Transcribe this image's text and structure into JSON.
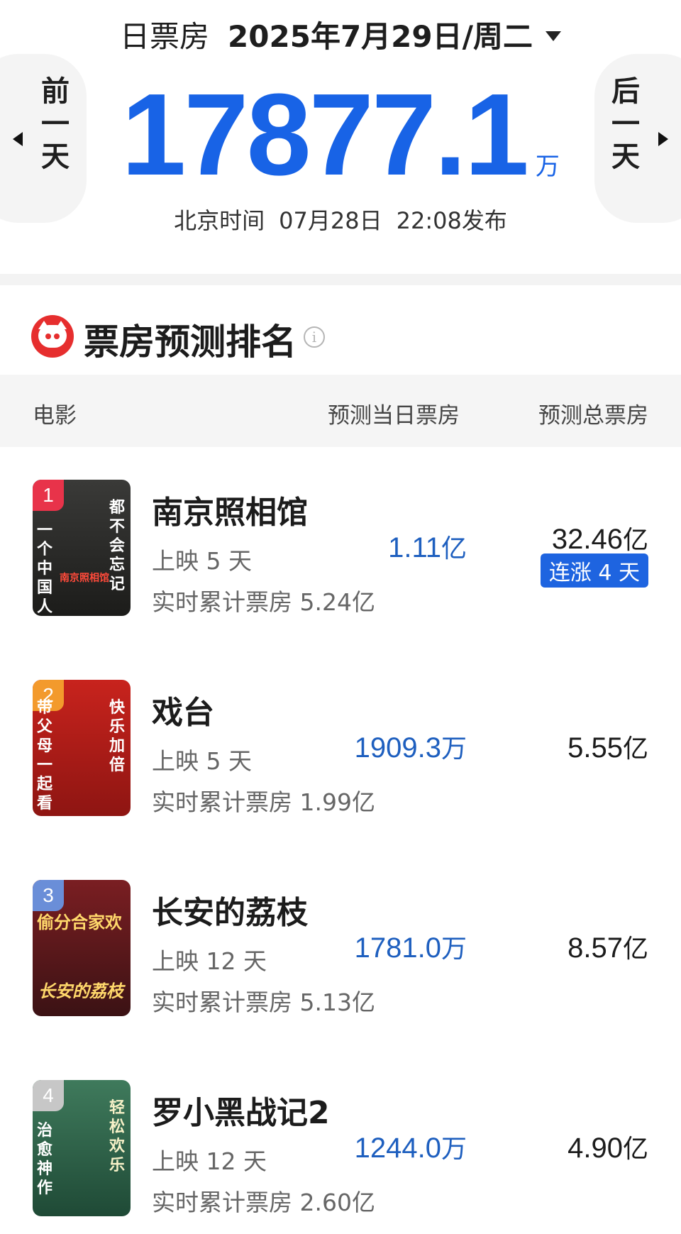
{
  "header": {
    "label": "日票房",
    "date": "2025年7月29日/周二",
    "prev_btn": "前一天",
    "next_btn": "后一天",
    "total_value": "17877.1",
    "total_unit": "万",
    "release_prefix": "北京时间",
    "release_date": "07月28日",
    "release_time": "22:08发布"
  },
  "section": {
    "title": "票房预测排名",
    "info": "i",
    "col_movie": "电影",
    "col_day_pred": "预测当日票房",
    "col_total_pred": "预测总票房"
  },
  "movies": [
    {
      "rank": "1",
      "title": "南京照相馆",
      "days": "上映 5 天",
      "cumulative": "实时累计票房 5.24亿",
      "pred_value": "1.11",
      "pred_unit": "亿",
      "total_value": "32.46",
      "total_unit": "亿",
      "tag": "连涨 4 天",
      "poster_left": "一个中国人",
      "poster_right": "都不会忘记",
      "poster_mid": "南京照相馆",
      "badge_color": "#e8334a",
      "poster_colors": [
        "#3a3a38",
        "#1c1c1a"
      ]
    },
    {
      "rank": "2",
      "title": "戏台",
      "days": "上映 5 天",
      "cumulative": "实时累计票房 1.99亿",
      "pred_value": "1909.3",
      "pred_unit": "万",
      "total_value": "5.55",
      "total_unit": "亿",
      "poster_left": "带父母一起看",
      "poster_right": "快乐加倍",
      "badge_color": "#f39a2c",
      "poster_colors": [
        "#c8231d",
        "#8e1512"
      ]
    },
    {
      "rank": "3",
      "title": "长安的荔枝",
      "days": "上映 12 天",
      "cumulative": "实时累计票房 5.13亿",
      "pred_value": "1781.0",
      "pred_unit": "万",
      "total_value": "8.57",
      "total_unit": "亿",
      "poster_top": "偷分合家欢",
      "poster_bottom": "长安的荔枝",
      "badge_color": "#6a8ed8",
      "poster_colors": [
        "#7a1e22",
        "#3b1214"
      ]
    },
    {
      "rank": "4",
      "title": "罗小黑战记2",
      "days": "上映 12 天",
      "cumulative": "实时累计票房 2.60亿",
      "pred_value": "1244.0",
      "pred_unit": "万",
      "total_value": "4.90",
      "total_unit": "亿",
      "poster_left": "治愈神作",
      "poster_right": "轻松欢乐",
      "badge_color": "#c7c7c7",
      "poster_colors": [
        "#3f7a5c",
        "#1f4a36"
      ]
    }
  ]
}
